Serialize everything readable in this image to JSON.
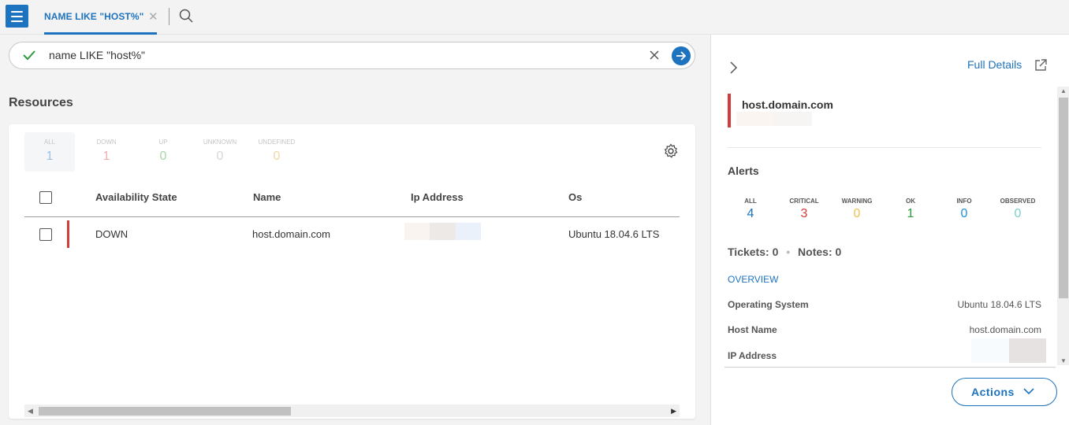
{
  "topbar": {
    "tab_label": "NAME LIKE \"HOST%\"",
    "tab_close": "✕"
  },
  "query": {
    "text": "name LIKE \"host%\""
  },
  "resources": {
    "title": "Resources",
    "states": [
      {
        "label": "ALL",
        "count": "1",
        "color": "#9cc3e6",
        "selected": true
      },
      {
        "label": "DOWN",
        "count": "1",
        "color": "#eeb0b0"
      },
      {
        "label": "UP",
        "count": "0",
        "color": "#a8d6a8"
      },
      {
        "label": "UNKNOWN",
        "count": "0",
        "color": "#d8d8d8"
      },
      {
        "label": "UNDEFINED",
        "count": "0",
        "color": "#f0d7a6"
      }
    ],
    "columns": [
      "Availability State",
      "Name",
      "Ip Address",
      "Os"
    ],
    "rows": [
      {
        "state": "DOWN",
        "name": "host.domain.com",
        "os": "Ubuntu 18.04.6 LTS"
      }
    ]
  },
  "panel": {
    "full_details": "Full Details",
    "host_name": "host.domain.com",
    "alerts_title": "Alerts",
    "alerts": [
      {
        "label": "ALL",
        "count": "4",
        "color": "#1e73be"
      },
      {
        "label": "CRITICAL",
        "count": "3",
        "color": "#d23c3c"
      },
      {
        "label": "WARNING",
        "count": "0",
        "color": "#f2c14e"
      },
      {
        "label": "OK",
        "count": "1",
        "color": "#2e9a3e"
      },
      {
        "label": "INFO",
        "count": "0",
        "color": "#1e8fe0"
      },
      {
        "label": "OBSERVED",
        "count": "0",
        "color": "#7ccfcf"
      }
    ],
    "tickets_label": "Tickets:",
    "tickets_count": "0",
    "notes_label": "Notes:",
    "notes_count": "0",
    "overview": "OVERVIEW",
    "overview_items": [
      {
        "label": "Operating System",
        "value": "Ubuntu 18.04.6 LTS"
      },
      {
        "label": "Host Name",
        "value": "host.domain.com"
      },
      {
        "label": "IP Address",
        "value": ""
      }
    ],
    "actions": "Actions"
  },
  "colors": {
    "accent": "#1e73be",
    "critical": "#d23c3c"
  }
}
